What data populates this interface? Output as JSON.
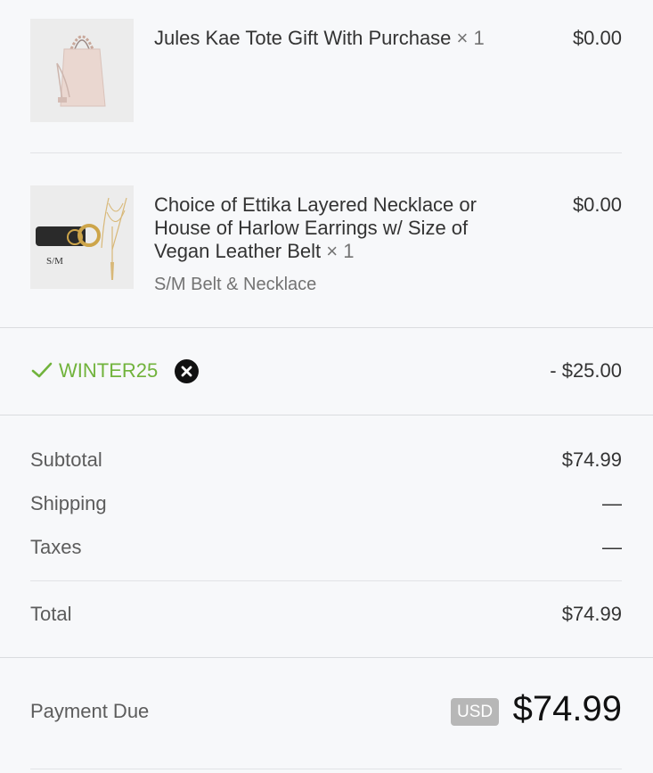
{
  "items": [
    {
      "title": "Jules Kae Tote Gift With Purchase",
      "quantity": "× 1",
      "price": "$0.00",
      "image_icon": "tote-bag-image"
    },
    {
      "title": "Choice of Ettika Layered Necklace or House of Harlow Earrings w/ Size of Vegan Leather Belt",
      "quantity": "× 1",
      "variant": "S/M Belt & Necklace",
      "price": "$0.00",
      "image_icon": "belt-necklace-image",
      "image_caption": "S/M"
    }
  ],
  "discount": {
    "code": "WINTER25",
    "amount": "- $25.00",
    "color": "#71b33c"
  },
  "summary": {
    "subtotal_label": "Subtotal",
    "subtotal_value": "$74.99",
    "shipping_label": "Shipping",
    "shipping_value": "—",
    "taxes_label": "Taxes",
    "taxes_value": "—",
    "total_label": "Total",
    "total_value": "$74.99"
  },
  "payment": {
    "label": "Payment Due",
    "currency": "USD",
    "amount": "$74.99"
  }
}
